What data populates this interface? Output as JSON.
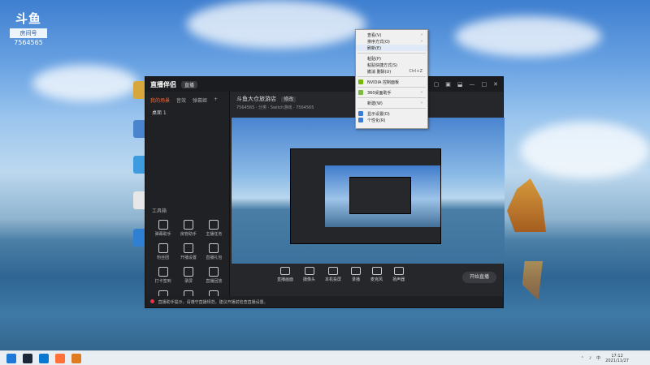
{
  "watermark": {
    "logo": "斗鱼",
    "room_label": "房间号",
    "room_number": "7564565"
  },
  "window": {
    "brand": "直播伴侣",
    "version_badge": "直播",
    "title_controls": [
      "⬒",
      "▢",
      "▣",
      "⬓",
      "—",
      "□",
      "✕"
    ],
    "sidebar": {
      "tabs": [
        "我的场景",
        "音效",
        "弹幕姬",
        "+"
      ],
      "active_tab_index": 0,
      "scene_label": "桌面 1",
      "tools_title": "工具箱",
      "tools": [
        "弹幕助手",
        "房管助手",
        "主播任务",
        "粉丝团",
        "开播设置",
        "直播礼包",
        "打卡签到",
        "录屏",
        "直播回放",
        "直播",
        "",
        "更多"
      ]
    },
    "room": {
      "title": "斗鱼大仓旅游店",
      "edit_label": "修改",
      "meta": "7564565 · 分类 · Switch游戏 · 7564565"
    },
    "controls": [
      "直播画面",
      "摄像头",
      "本机投屏",
      "录播",
      "麦克风",
      "扬声器"
    ],
    "golive_label": "开始直播",
    "status_text": "直播助手提示，请遵守直播规范，建议开播前检查直播设置。"
  },
  "context_menu": {
    "items": [
      {
        "label": "查看(V)",
        "arrow": "›"
      },
      {
        "label": "排序方式(O)",
        "arrow": "›"
      },
      {
        "label": "刷新(E)",
        "selected": true
      },
      {
        "sep": true
      },
      {
        "label": "粘贴(P)"
      },
      {
        "label": "粘贴快捷方式(S)"
      },
      {
        "label": "撤消 删除(U)",
        "shortcut": "Ctrl+Z"
      },
      {
        "sep": true
      },
      {
        "label": "NVIDIA 控制面板",
        "icon_color": "#76b900"
      },
      {
        "sep": true
      },
      {
        "label": "360桌面助手",
        "arrow": "›",
        "icon_color": "#7dbb3e"
      },
      {
        "sep": true
      },
      {
        "label": "新建(W)",
        "arrow": "›"
      },
      {
        "sep": true
      },
      {
        "label": "显示设置(D)",
        "icon_color": "#3b7bd5"
      },
      {
        "label": "个性化(R)",
        "icon_color": "#3b7bd5"
      }
    ]
  },
  "taskbar": {
    "apps": [
      "windows-logo",
      "steam",
      "edge",
      "firefox",
      "store"
    ],
    "tray_lang": "中",
    "time": "17:12",
    "date": "2021/11/27"
  }
}
